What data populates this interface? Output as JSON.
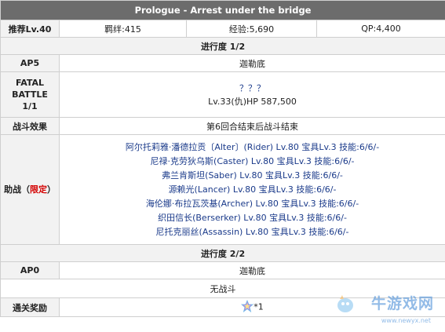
{
  "title": "Prologue - Arrest under the bridge",
  "stats": {
    "level_label": "推荐Lv.40",
    "bond": "羁绊:415",
    "exp": "经验:5,690",
    "qp": "QP:4,400"
  },
  "progress1": {
    "header": "进行度 1/2",
    "ap_label": "AP5",
    "ap_enemy": "迦勒底",
    "fatal_label_1": "FATAL",
    "fatal_label_2": "BATTLE",
    "fatal_label_3": "1/1",
    "fatal_enemy": "？？？",
    "fatal_hp": "Lv.33(仇)HP 587,500",
    "effect_label": "战斗效果",
    "effect_value": "第6回合结束后战斗结束",
    "support_label_prefix": "助战（",
    "support_label_red": "限定",
    "support_label_suffix": "）",
    "support_list": [
      "阿尔托莉雅·潘德拉贡〔Alter〕(Rider) Lv.80 宝具Lv.3 技能:6/6/-",
      "尼禄·克劳狄乌斯(Caster) Lv.80 宝具Lv.3 技能:6/6/-",
      "弗兰肯斯坦(Saber) Lv.80 宝具Lv.3 技能:6/6/-",
      "源赖光(Lancer) Lv.80 宝具Lv.3 技能:6/6/-",
      "海伦娜·布拉瓦茨基(Archer) Lv.80 宝具Lv.3 技能:6/6/-",
      "织田信长(Berserker) Lv.80 宝具Lv.3 技能:6/6/-",
      "尼托克丽丝(Assassin) Lv.80 宝具Lv.3 技能:6/6/-"
    ]
  },
  "progress2": {
    "header": "进行度 2/2",
    "ap_label": "AP0",
    "ap_enemy": "迦勒底",
    "no_battle": "无战斗",
    "reward_label": "通关奖励",
    "reward_count": "*1",
    "reward_icon": "saint-quartz-icon"
  },
  "watermark": {
    "text": "牛游戏网",
    "url": "www.newyx.net"
  }
}
